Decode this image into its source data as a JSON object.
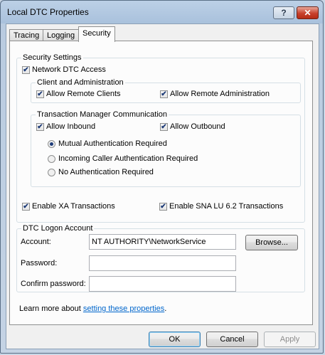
{
  "window": {
    "title": "Local DTC Properties",
    "help_label": "?",
    "close_label": "✕"
  },
  "tabs": [
    {
      "label": "Tracing"
    },
    {
      "label": "Logging"
    },
    {
      "label": "Security"
    }
  ],
  "security_settings": {
    "legend": "Security Settings",
    "network_dtc_access": {
      "label": "Network DTC Access",
      "checked": true
    },
    "client_admin": {
      "legend": "Client and Administration",
      "allow_remote_clients": {
        "label": "Allow Remote Clients",
        "checked": true
      },
      "allow_remote_admin": {
        "label": "Allow Remote Administration",
        "checked": true
      }
    },
    "tm_comm": {
      "legend": "Transaction Manager Communication",
      "allow_inbound": {
        "label": "Allow Inbound",
        "checked": true
      },
      "allow_outbound": {
        "label": "Allow Outbound",
        "checked": true
      },
      "radios": [
        {
          "label": "Mutual Authentication Required",
          "selected": true
        },
        {
          "label": "Incoming Caller Authentication Required",
          "selected": false
        },
        {
          "label": "No Authentication Required",
          "selected": false
        }
      ]
    },
    "enable_xa": {
      "label": "Enable XA Transactions",
      "checked": true
    },
    "enable_sna": {
      "label": "Enable SNA LU 6.2 Transactions",
      "checked": true
    }
  },
  "logon": {
    "legend": "DTC Logon Account",
    "account_label": "Account:",
    "account_value": "NT AUTHORITY\\NetworkService",
    "browse_label": "Browse...",
    "password_label": "Password:",
    "password_value": "",
    "confirm_label": "Confirm password:",
    "confirm_value": ""
  },
  "learn_more": {
    "prefix": "Learn more about ",
    "link": "setting these properties",
    "suffix": "."
  },
  "footer": {
    "ok_label": "OK",
    "cancel_label": "Cancel",
    "apply_label": "Apply"
  },
  "check_glyph": "✔"
}
